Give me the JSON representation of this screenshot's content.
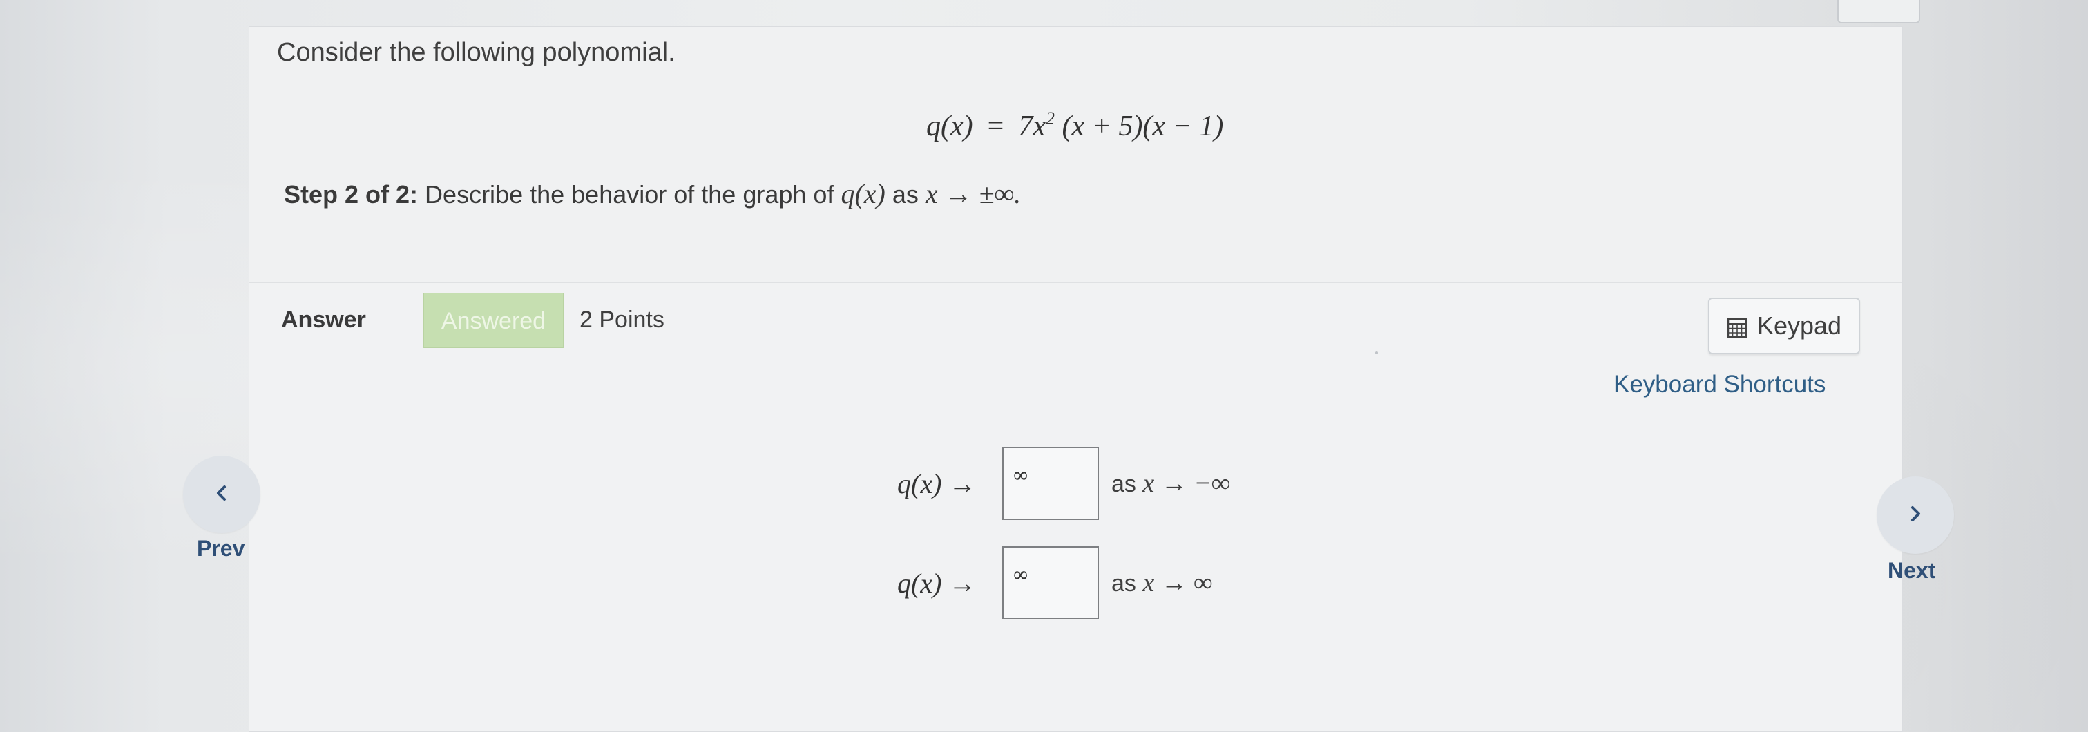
{
  "question": {
    "intro": "Consider the following polynomial.",
    "polynomial": {
      "lhs": "q(x)",
      "equals": "=",
      "coefficient": "7x",
      "exponent": "2",
      "factors": "(x + 5)(x − 1)"
    },
    "step": {
      "label": "Step 2 of 2:",
      "text_before": "Describe the behavior of the graph of",
      "function": "q(x)",
      "text_as": "as",
      "limit": "x → ±∞."
    }
  },
  "answer": {
    "label": "Answer",
    "status_badge": "Answered",
    "points": "2 Points",
    "keypad_label": "Keypad",
    "shortcuts_label": "Keyboard Shortcuts",
    "rows": [
      {
        "lhs": "q(x) →",
        "value": "∞",
        "as_word": "as",
        "condition": "x → −∞"
      },
      {
        "lhs": "q(x) →",
        "value": "∞",
        "as_word": "as",
        "condition": "x → ∞"
      }
    ]
  },
  "navigation": {
    "prev_label": "Prev",
    "next_label": "Next"
  },
  "colors": {
    "answered_badge": "#c6dfb1",
    "link": "#2f5e86",
    "nav_text": "#2f4f77",
    "nav_circle": "#dfe3e8"
  },
  "icons": {
    "keypad": "calculator-keypad-icon",
    "prev": "chevron-left-icon",
    "next": "chevron-right-icon"
  }
}
